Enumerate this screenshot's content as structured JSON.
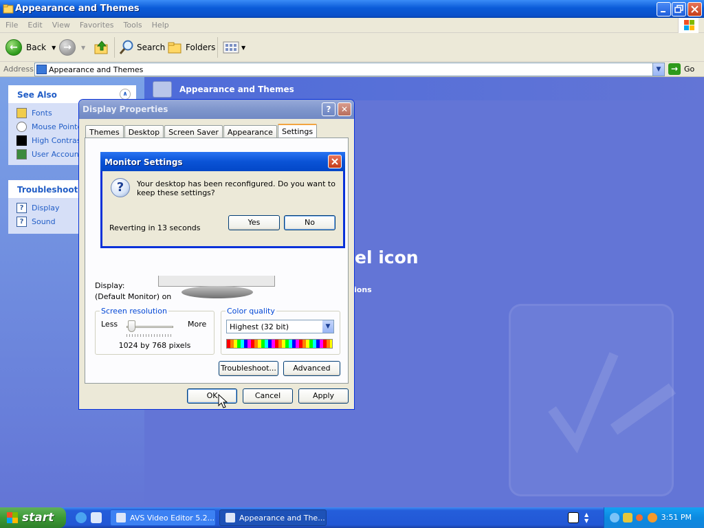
{
  "explorer": {
    "title": "Appearance and Themes",
    "menu": [
      "File",
      "Edit",
      "View",
      "Favorites",
      "Tools",
      "Help"
    ],
    "toolbar": {
      "back_label": "Back",
      "search_label": "Search",
      "folders_label": "Folders"
    },
    "address": {
      "label": "Address",
      "value": "Appearance and Themes",
      "go_label": "Go"
    },
    "see_also": {
      "title": "See Also",
      "items": [
        "Fonts",
        "Mouse Pointers",
        "High Contrast",
        "User Account Picture"
      ]
    },
    "troubleshooters": {
      "title": "Troubleshooters",
      "items": [
        "Display",
        "Sound"
      ]
    },
    "main_title": "Appearance and Themes",
    "bg_text_1": "el icon",
    "bg_text_2": "ions"
  },
  "display_properties": {
    "title": "Display Properties",
    "help_glyph": "?",
    "close_glyph": "✕",
    "tabs": [
      "Themes",
      "Desktop",
      "Screen Saver",
      "Appearance",
      "Settings"
    ],
    "active_tab": "Settings",
    "display_label": "Display:",
    "display_value": "(Default Monitor) on",
    "resolution": {
      "legend": "Screen resolution",
      "less": "Less",
      "more": "More",
      "value": "1024 by 768 pixels",
      "slider_fraction": 0.1
    },
    "color_quality": {
      "legend": "Color quality",
      "selected": "Highest (32 bit)"
    },
    "buttons": {
      "troubleshoot": "Troubleshoot...",
      "advanced": "Advanced",
      "ok": "OK",
      "cancel": "Cancel",
      "apply": "Apply"
    }
  },
  "monitor_settings": {
    "title": "Monitor Settings",
    "message": "Your desktop has been reconfigured.  Do you want to keep these settings?",
    "reverting": "Reverting in 13 seconds",
    "yes_label": "Yes",
    "no_label": "No",
    "icon_glyph": "?"
  },
  "taskbar": {
    "start_label": "start",
    "tasks": [
      "AVS Video Editor 5.2....",
      "Appearance and The..."
    ],
    "clock": "3:51 PM"
  },
  "colors": {
    "xp_blue": "#0a53d6",
    "content_bg": "#6375d6",
    "link_blue": "#215dc6",
    "start_green": "#3c9a35"
  }
}
